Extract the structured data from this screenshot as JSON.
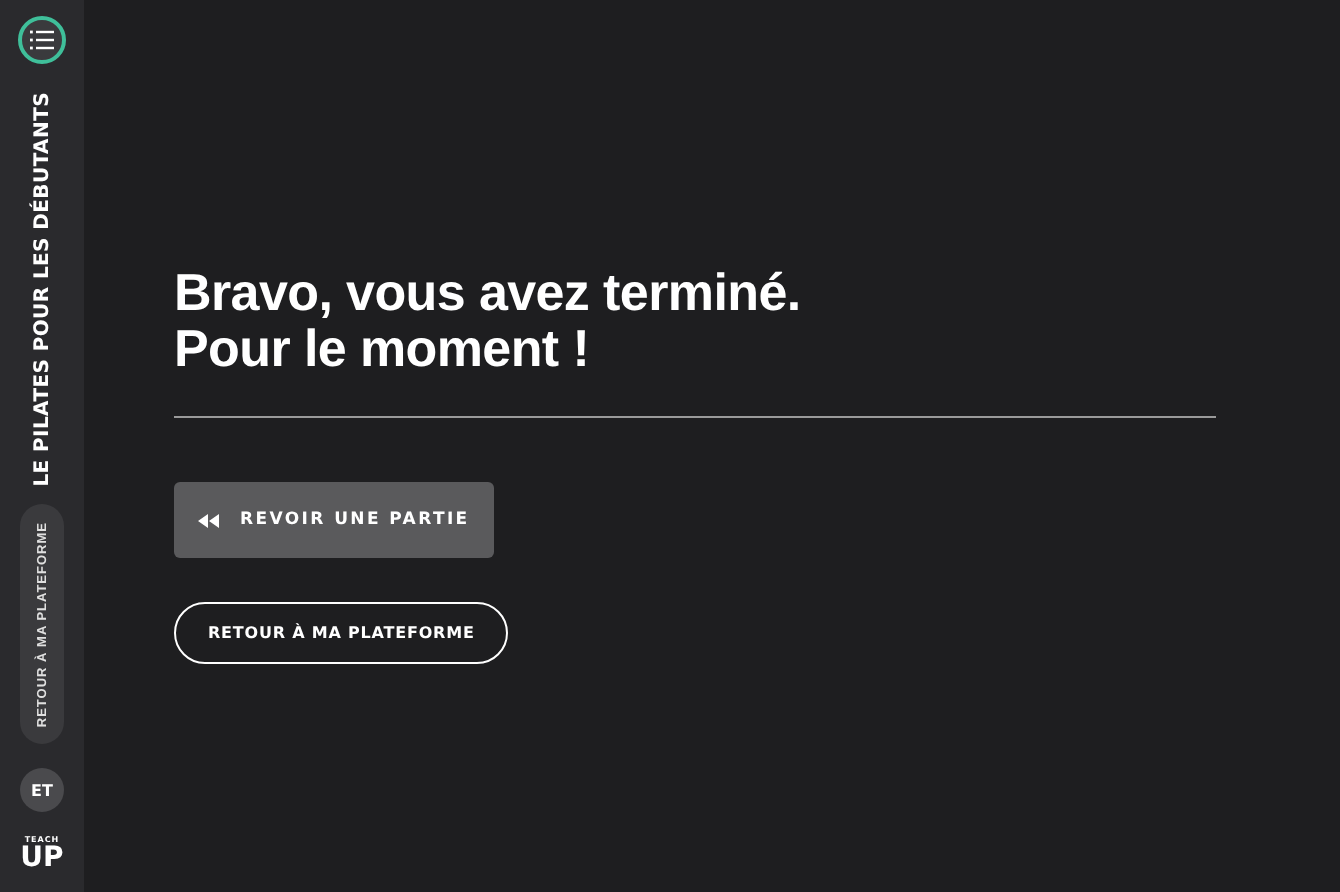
{
  "sidebar": {
    "course_title": "LE PILATES POUR LES DÉBUTANTS",
    "back_button": "RETOUR À MA PLATEFORME",
    "avatar": "ET",
    "logo": {
      "top": "TEACH",
      "bottom": "UP"
    }
  },
  "main": {
    "heading_lines": [
      "Bravo, vous avez terminé.",
      "Pour le moment !"
    ],
    "buttons": [
      {
        "kind": "filled",
        "label": "REVOIR UNE PARTIE"
      },
      {
        "kind": "outline",
        "label": "RETOUR À MA PLATEFORME"
      }
    ]
  }
}
